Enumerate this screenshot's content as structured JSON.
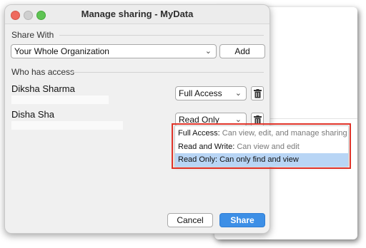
{
  "dialog": {
    "title": "Manage sharing - MyData",
    "share_with": {
      "label": "Share With",
      "selected": "Your Whole Organization",
      "add_label": "Add"
    },
    "access": {
      "label": "Who has access",
      "people": [
        {
          "name": "Diksha Sharma",
          "permission": "Full Access"
        },
        {
          "name": "Disha Sha",
          "permission": "Read Only"
        }
      ]
    },
    "permission_menu": [
      {
        "name": "Full Access",
        "desc": "Can view, edit, and manage sharing",
        "selected": false
      },
      {
        "name": "Read and Write",
        "desc": "Can view and edit",
        "selected": false
      },
      {
        "name": "Read Only",
        "desc": "Can only find and view",
        "selected": true
      }
    ],
    "cancel_label": "Cancel",
    "share_label": "Share"
  },
  "colors": {
    "accent": "#3d8fe6",
    "selection": "#b8d5f5",
    "highlight": "#e0342a"
  },
  "icons": [
    "trash-icon",
    "chevron-down-icon"
  ]
}
